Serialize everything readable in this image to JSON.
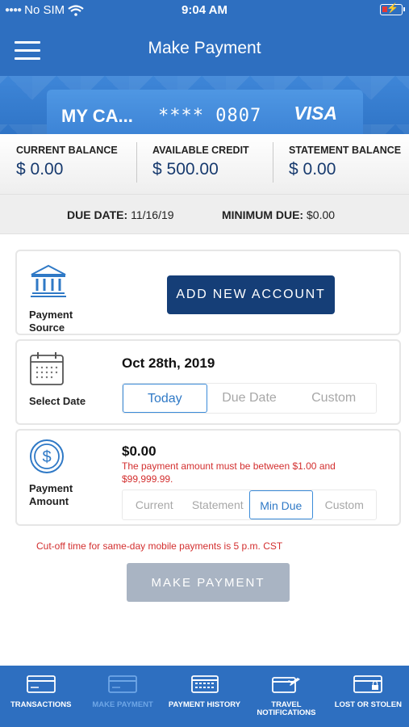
{
  "status_bar": {
    "carrier": "No SIM",
    "time": "9:04 AM"
  },
  "header": {
    "title": "Make Payment"
  },
  "card": {
    "name": "MY CA...",
    "masked_number": "**** 0807",
    "brand": "VISA"
  },
  "balances": [
    {
      "label": "CURRENT BALANCE",
      "value": "$ 0.00"
    },
    {
      "label": "AVAILABLE CREDIT",
      "value": "$ 500.00"
    },
    {
      "label": "STATEMENT BALANCE",
      "value": "$ 0.00"
    }
  ],
  "due": {
    "due_date_label": "DUE DATE:",
    "due_date_value": "11/16/19",
    "min_due_label": "MINIMUM DUE:",
    "min_due_value": "$0.00"
  },
  "payment_source": {
    "label": "Payment Source",
    "button": "ADD NEW ACCOUNT"
  },
  "select_date": {
    "label": "Select Date",
    "date": "Oct 28th, 2019",
    "options": [
      "Today",
      "Due Date",
      "Custom"
    ],
    "selected": "Today"
  },
  "payment_amount": {
    "label": "Payment Amount",
    "amount": "$0.00",
    "error": "The payment amount must be between $1.00 and $99,999.99.",
    "options": [
      "Current",
      "Statement",
      "Min Due",
      "Custom"
    ],
    "selected": "Min Due"
  },
  "cutoff_note": "Cut-off time for same-day mobile payments is 5 p.m. CST",
  "make_payment_button": "MAKE PAYMENT",
  "bottom_nav": [
    {
      "label": "TRANSACTIONS",
      "icon": "card-icon"
    },
    {
      "label": "MAKE PAYMENT",
      "icon": "payment-card-icon",
      "active": true
    },
    {
      "label": "PAYMENT HISTORY",
      "icon": "calendar-card-icon"
    },
    {
      "label": "TRAVEL NOTIFICATIONS",
      "icon": "airplane-card-icon"
    },
    {
      "label": "LOST OR STOLEN",
      "icon": "lock-card-icon"
    }
  ],
  "colors": {
    "primary": "#2e6fc0",
    "navy": "#153e77",
    "error": "#d32f2f",
    "disabled": "#a9b4c3"
  }
}
